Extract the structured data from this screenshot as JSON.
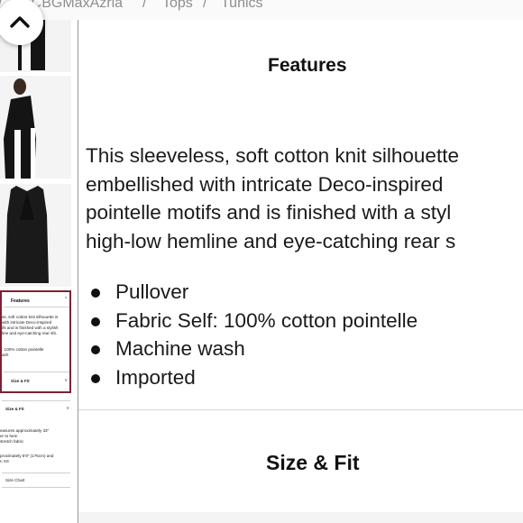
{
  "breadcrumb": {
    "items": [
      "BCBGMaxAzria",
      "Tops",
      "Tunics"
    ],
    "separator": "/"
  },
  "nav": {
    "scroll_up_icon": "chevron-up-icon"
  },
  "features": {
    "heading": "Features",
    "description_lines": [
      "This sleeveless, soft cotton knit silhouette",
      "embellished with intricate Deco-inspired",
      "pointelle motifs and is finished with a styl",
      "high-low hemline and eye-catching rear s"
    ],
    "bullets": [
      "Pullover",
      "Fabric Self: 100% cotton pointelle",
      "Machine wash",
      "Imported"
    ]
  },
  "size_fit": {
    "heading": "Size & Fit"
  },
  "thumbnail_panel": {
    "features_heading": "Features",
    "text_lines": [
      "ss, soft cotton knit silhouette is",
      "with intricate Deco-inspired",
      "ifs and is finished with a stylish",
      "line and eye-catching rear slit.",
      ": 100% cotton pointelle",
      "ash"
    ],
    "size_fit_heading": "Size & Fit"
  },
  "thumbnail_panel_lower": {
    "size_fit_heading": "Size & Fit",
    "text_lines": [
      "easures approximately 33\"",
      "er to hem",
      "stretch fabric",
      "proximately 5'9\" (175cm) and",
      "n XS"
    ],
    "size_chart_label": "Size Chart"
  },
  "colors": {
    "highlight_border": "#7b2233",
    "garment": "#141414",
    "divider": "#9a9a9a"
  }
}
